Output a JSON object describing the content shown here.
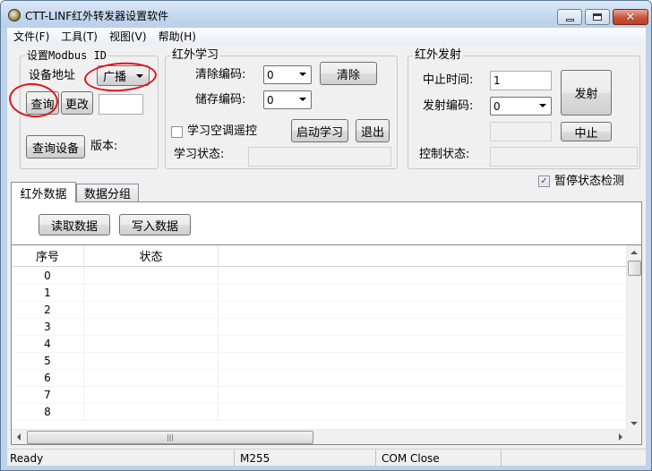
{
  "window": {
    "title": "CTT-LINF红外转发器设置软件"
  },
  "menu": [
    "文件(F)",
    "工具(T)",
    "视图(V)",
    "帮助(H)"
  ],
  "modbus": {
    "title": "设置Modbus ID",
    "address_label": "设备地址",
    "address_value": "广播",
    "query_button": "查询",
    "change_button": "更改",
    "change_value": "",
    "query_device_button": "查询设备",
    "version_label": "版本:"
  },
  "ir_learn": {
    "title": "红外学习",
    "clear_code_label": "清除编码:",
    "clear_code_value": "0",
    "clear_button": "清除",
    "store_code_label": "储存编码:",
    "store_code_value": "0",
    "ac_remote_label": "学习空调遥控",
    "start_learn_button": "启动学习",
    "exit_button": "退出",
    "learn_status_label": "学习状态:"
  },
  "ir_send": {
    "title": "红外发射",
    "stop_time_label": "中止时间:",
    "stop_time_value": "1",
    "send_code_label": "发射编码:",
    "send_code_value": "0",
    "send_button": "发射",
    "stop_button": "中止",
    "control_status_label": "控制状态:"
  },
  "pause_check": {
    "label": "暂停状态检测",
    "checked": true
  },
  "tabs": [
    {
      "label": "红外数据",
      "active": true
    },
    {
      "label": "数据分组",
      "active": false
    }
  ],
  "panel": {
    "read_button": "读取数据",
    "write_button": "写入数据"
  },
  "table": {
    "columns": [
      "序号",
      "状态"
    ],
    "rows": [
      "0",
      "1",
      "2",
      "3",
      "4",
      "5",
      "6",
      "7",
      "8"
    ]
  },
  "status_bar": [
    "Ready",
    "M255",
    "COM Close"
  ]
}
